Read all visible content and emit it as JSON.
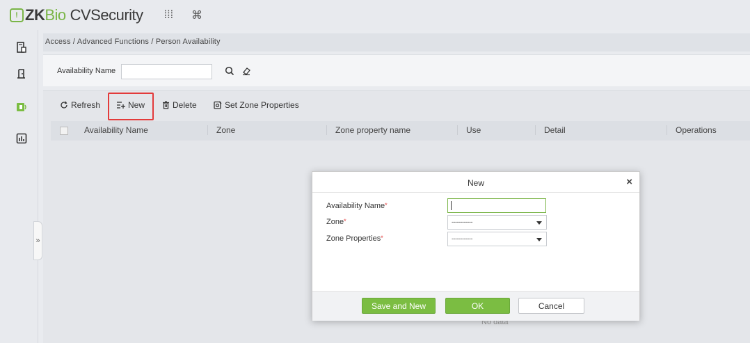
{
  "app": {
    "logo_mark": "!",
    "logo_zk": "ZK",
    "logo_bio": "Bio",
    "logo_rest": "CVSecurity",
    "menu_icon_glyph": "⁞⁞⁞",
    "command_icon_glyph": "⌘"
  },
  "breadcrumb": "Access / Advanced Functions / Person Availability",
  "search": {
    "label": "Availability Name",
    "value": "",
    "placeholder": ""
  },
  "toolbar": {
    "refresh": "Refresh",
    "new": "New",
    "delete": "Delete",
    "set_zone": "Set Zone Properties"
  },
  "grid": {
    "columns": [
      "Availability Name",
      "Zone",
      "Zone property name",
      "Use",
      "Detail",
      "Operations"
    ],
    "no_data": "No data"
  },
  "collapse_glyph": "»",
  "modal": {
    "title": "New",
    "close_glyph": "×",
    "fields": [
      {
        "label": "Availability Name",
        "required": "*",
        "value": ""
      },
      {
        "label": "Zone",
        "required": "*",
        "value": "------------"
      },
      {
        "label": "Zone Properties",
        "required": "*",
        "value": "------------"
      }
    ],
    "buttons": {
      "save_new": "Save and New",
      "ok": "OK",
      "cancel": "Cancel"
    }
  },
  "colors": {
    "accent_green": "#7bbd42",
    "highlight_red": "#e33b3b"
  }
}
